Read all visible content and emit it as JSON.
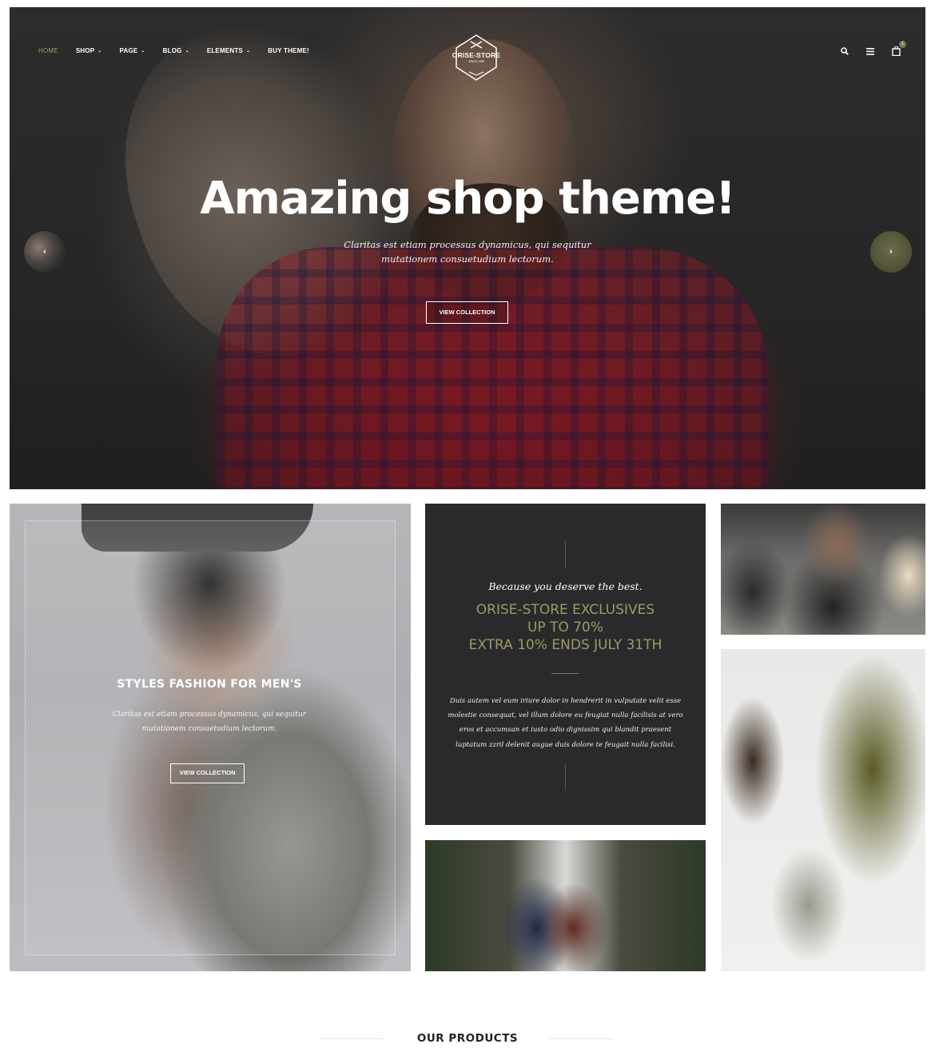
{
  "nav": {
    "items": [
      {
        "label": "HOME",
        "active": true,
        "dropdown": false
      },
      {
        "label": "SHOP",
        "active": false,
        "dropdown": true
      },
      {
        "label": "PAGE",
        "active": false,
        "dropdown": true
      },
      {
        "label": "BLOG",
        "active": false,
        "dropdown": true
      },
      {
        "label": "ELEMENTS",
        "active": false,
        "dropdown": true
      },
      {
        "label": "BUY THEME!",
        "active": false,
        "dropdown": false
      }
    ],
    "active_color": "#9d9a6a"
  },
  "logo": {
    "name": "ORISE-STORE",
    "tagline": "SINCE 1985"
  },
  "header_icons": {
    "search": "search-icon",
    "menu": "menu-icon",
    "cart": "cart-icon",
    "cart_count": "1"
  },
  "hero": {
    "title": "Amazing shop theme!",
    "text": "Claritas est etiam processus dynamicus, qui sequitur mutationem consuetudium lectorum.",
    "button": "VIEW COLLECTION",
    "prev_arrow": "‹",
    "next_arrow": "›"
  },
  "tile_men": {
    "title": "STYLES FASHION FOR MEN'S",
    "text": "Claritas est etiam processus dynamicus, qui sequitur mutationem consuetudium lectorum.",
    "button": "VIEW COLLECTION"
  },
  "promo": {
    "script": "Because you deserve the best.",
    "heading_lines": [
      "ORISE-STORE EXCLUSIVES",
      "UP TO 70%",
      "EXTRA 10% ENDS JULY 31TH"
    ],
    "text": "Duis autem vel eum iriure dolor in hendrerit in vulputate velit esse molestie consequat, vel illum dolore eu feugiat nulla facilisis at vero eros et accumsan et iusto odio dignissim qui blandit praesent luptatum zzril delenit augue duis dolore te feugait nulla facilisi.",
    "accent_color": "#9e9b66"
  },
  "products": {
    "title": "OUR PRODUCTS"
  }
}
